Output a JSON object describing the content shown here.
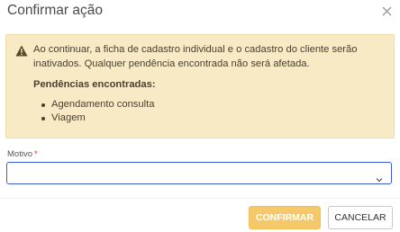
{
  "dialog": {
    "title": "Confirmar ação",
    "close_icon": "close-icon"
  },
  "alert": {
    "icon": "warning-icon",
    "message": "Ao continuar, a ficha de cadastro individual e o cadastro do cliente serão inativados. Qualquer pendência encontrada não será afetada.",
    "heading": "Pendências encontradas:",
    "items": [
      "Agendamento consulta",
      "Viagem"
    ],
    "background": "#f8eac5"
  },
  "form": {
    "motivo_label": "Motivo",
    "required_mark": "*",
    "motivo_value": "",
    "chevron_icon": "chevron-down-icon"
  },
  "actions": {
    "confirm_label": "CONFIRMAR",
    "cancel_label": "CANCELAR",
    "confirm_color": "#f5c96a"
  }
}
